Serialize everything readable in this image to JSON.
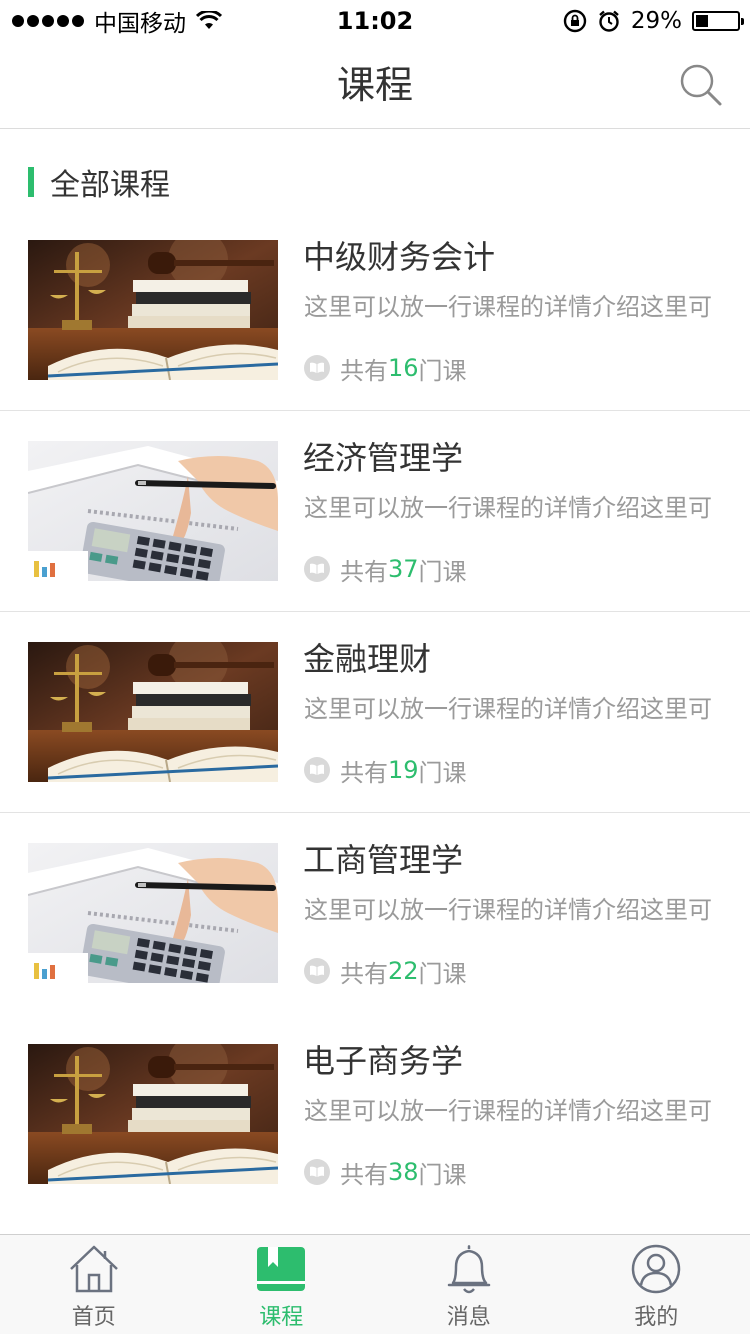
{
  "status_bar": {
    "carrier": "中国移动",
    "time": "11:02",
    "battery_percent": "29%",
    "battery_level": 0.29,
    "icons": [
      "signal-dots-icon",
      "wifi-icon",
      "rotation-lock-icon",
      "alarm-icon",
      "battery-icon"
    ]
  },
  "nav": {
    "title": "课程",
    "search_icon": "search-icon"
  },
  "section": {
    "title": "全部课程"
  },
  "courses": [
    {
      "name": "中级财务会计",
      "desc": "这里可以放一行课程的详情介绍这里可",
      "count_prefix": "共有",
      "count": "16",
      "count_suffix": "门课",
      "thumbnail": "law-books-scale-image"
    },
    {
      "name": "经济管理学",
      "desc": "这里可以放一行课程的详情介绍这里可",
      "count_prefix": "共有",
      "count": "37",
      "count_suffix": "门课",
      "thumbnail": "calculator-hand-image"
    },
    {
      "name": "金融理财",
      "desc": "这里可以放一行课程的详情介绍这里可",
      "count_prefix": "共有",
      "count": "19",
      "count_suffix": "门课",
      "thumbnail": "law-books-scale-image"
    },
    {
      "name": "工商管理学",
      "desc": "这里可以放一行课程的详情介绍这里可",
      "count_prefix": "共有",
      "count": "22",
      "count_suffix": "门课",
      "thumbnail": "calculator-hand-image"
    },
    {
      "name": "电子商务学",
      "desc": "这里可以放一行课程的详情介绍这里可",
      "count_prefix": "共有",
      "count": "38",
      "count_suffix": "门课",
      "thumbnail": "law-books-scale-image"
    }
  ],
  "tabs": [
    {
      "label": "首页",
      "icon": "home-icon",
      "active": false
    },
    {
      "label": "课程",
      "icon": "bookmark-book-icon",
      "active": true
    },
    {
      "label": "消息",
      "icon": "bell-icon",
      "active": false
    },
    {
      "label": "我的",
      "icon": "user-icon",
      "active": false
    }
  ],
  "colors": {
    "accent": "#2dbd6e",
    "text": "#333333",
    "secondary_text": "#9a9a9a",
    "inactive_icon": "#6b7280"
  }
}
